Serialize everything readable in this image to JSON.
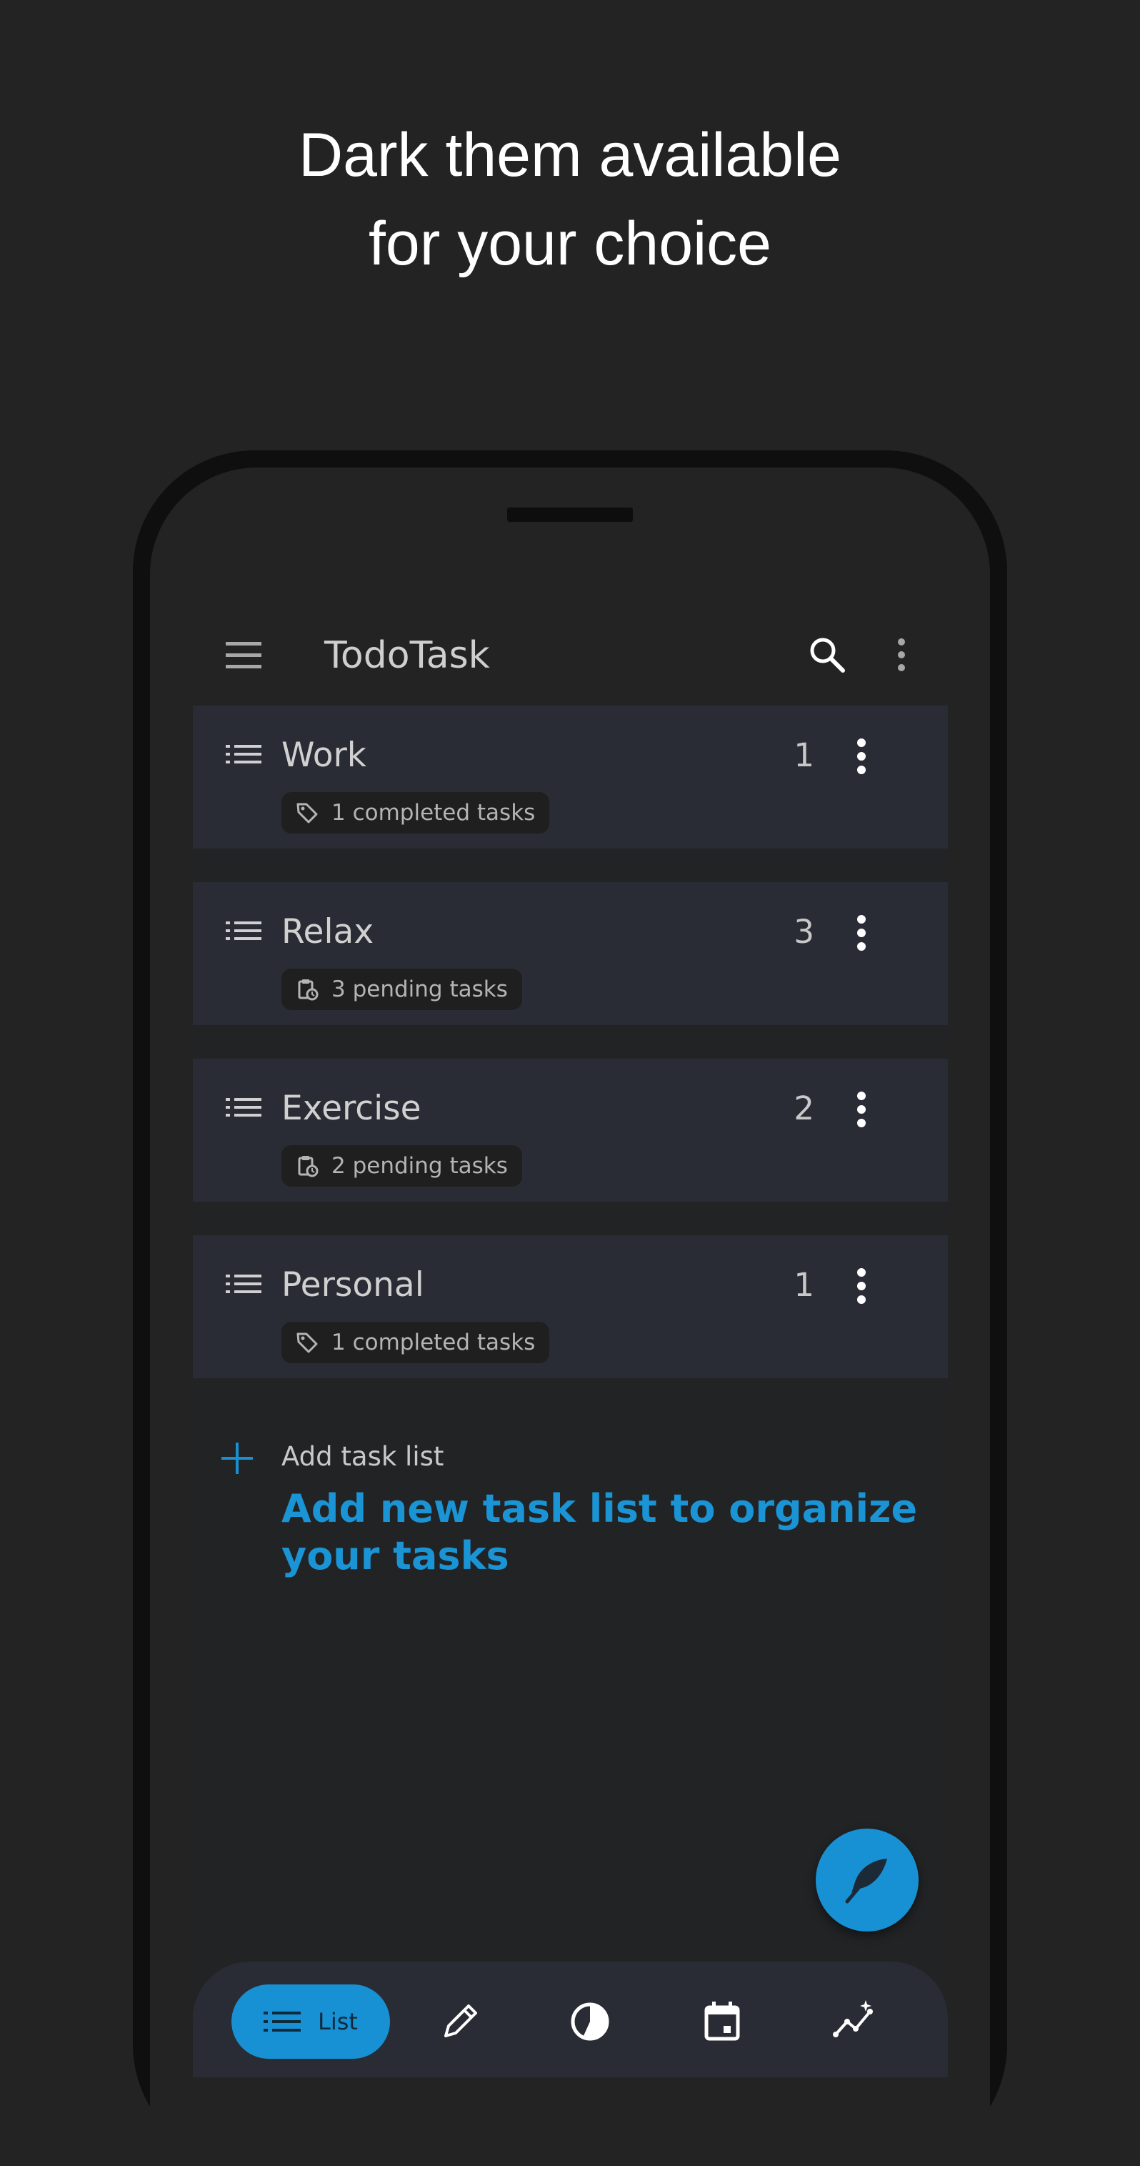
{
  "headline": {
    "line1": "Dark them available",
    "line2": "for your choice"
  },
  "app": {
    "title": "TodoTask"
  },
  "lists": [
    {
      "name": "Work",
      "count": "1",
      "status": "1 completed tasks",
      "status_icon": "tag-icon"
    },
    {
      "name": "Relax",
      "count": "3",
      "status": "3 pending tasks",
      "status_icon": "clipboard-clock-icon"
    },
    {
      "name": "Exercise",
      "count": "2",
      "status": "2 pending tasks",
      "status_icon": "clipboard-clock-icon"
    },
    {
      "name": "Personal",
      "count": "1",
      "status": "1 completed tasks",
      "status_icon": "tag-icon"
    }
  ],
  "add_list": {
    "label": "Add task list",
    "description": "Add new task list to organize your tasks"
  },
  "bottom_nav": {
    "list_label": "List",
    "items": [
      "list-icon",
      "pencil-icon",
      "pie-chart-icon",
      "calendar-icon",
      "trend-icon"
    ]
  },
  "colors": {
    "background": "#232323",
    "card": "#292c34",
    "accent": "#1791d3",
    "accent_text": "#1a94d4"
  }
}
